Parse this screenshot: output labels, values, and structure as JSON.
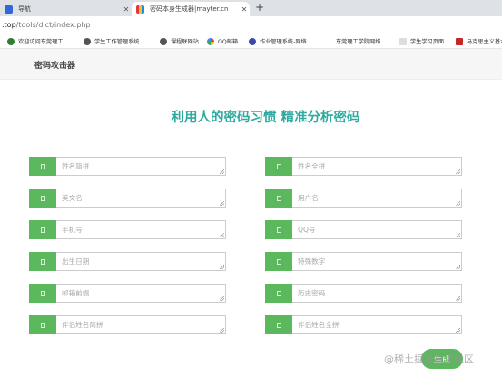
{
  "browser": {
    "tabs": [
      {
        "title": "导航"
      },
      {
        "title": "密码本身生成器|mayter.cn"
      }
    ],
    "new_tab_symbol": "+",
    "address": {
      "host": ".top",
      "path": "/tools/dict/index.php"
    },
    "bookmarks": [
      {
        "label": "欢迎访问东莞理工..."
      },
      {
        "label": "学生工作管理系统..."
      },
      {
        "label": "课程联网站"
      },
      {
        "label": "QQ邮箱"
      },
      {
        "label": "作业管理系统-网络..."
      },
      {
        "label": "东莞理工学院网络..."
      },
      {
        "label": "学生学习页面"
      },
      {
        "label": "马克思主义基本..."
      }
    ]
  },
  "page": {
    "brand": "密码攻击器",
    "headline": "利用人的密码习惯 精准分析密码",
    "fields_left": [
      {
        "placeholder": "姓名简拼"
      },
      {
        "placeholder": "英文名"
      },
      {
        "placeholder": "手机号"
      },
      {
        "placeholder": "出生日期"
      },
      {
        "placeholder": "邮箱前缀"
      },
      {
        "placeholder": "伴侣姓名简拼"
      }
    ],
    "fields_right": [
      {
        "placeholder": "姓名全拼"
      },
      {
        "placeholder": "用户名"
      },
      {
        "placeholder": "QQ号"
      },
      {
        "placeholder": "特殊数字"
      },
      {
        "placeholder": "历史密码"
      },
      {
        "placeholder": "伴侣姓名全拼"
      }
    ],
    "generate_label": "生成",
    "watermark": "@稀土掘金技术社区"
  },
  "colors": {
    "accent": "#2eaaa0",
    "addon": "#5cb85c"
  }
}
